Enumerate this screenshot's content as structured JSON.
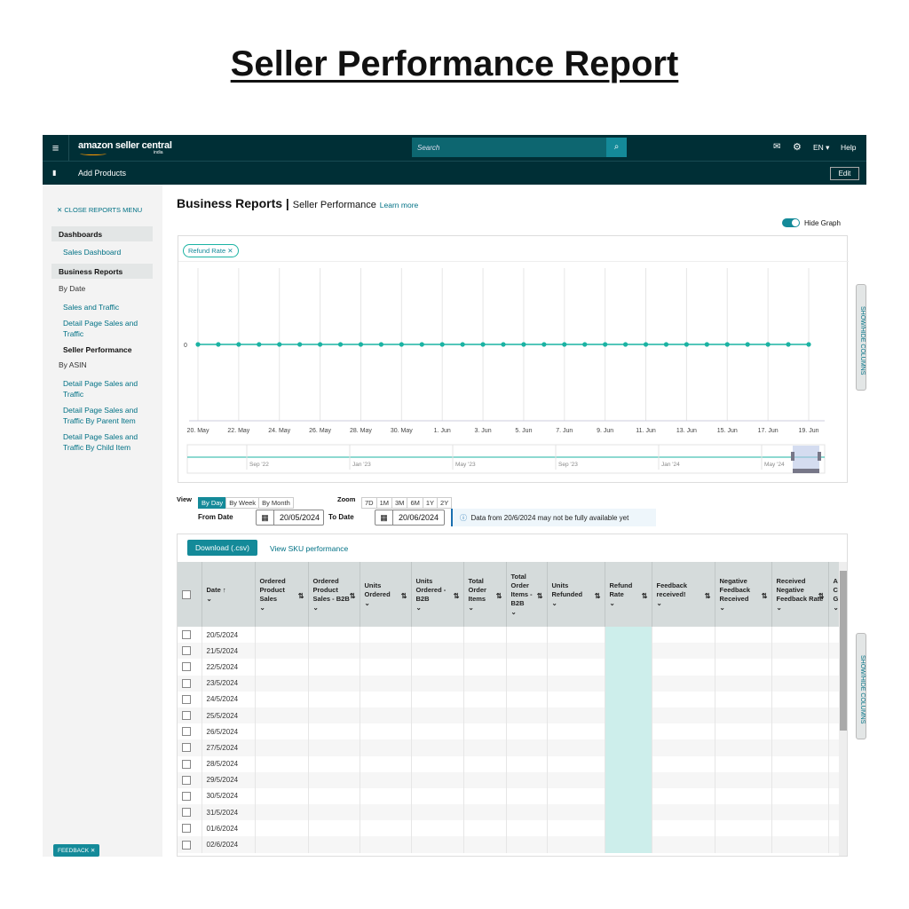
{
  "page_title": "Seller Performance Report",
  "topbar": {
    "logo": "amazon seller central",
    "logo_sub": "india",
    "search_placeholder": "Search",
    "language": "EN",
    "help": "Help",
    "icons": [
      "menu-icon",
      "search-icon",
      "mail-icon",
      "gear-icon"
    ]
  },
  "subbar": {
    "bookmark_label": "Add Products",
    "edit": "Edit"
  },
  "sidebar": {
    "close": "CLOSE REPORTS MENU",
    "dashboards": "Dashboards",
    "sales_dashboard": "Sales Dashboard",
    "business_reports": "Business Reports",
    "by_date": "By Date",
    "sales_traffic": "Sales and Traffic",
    "detail_sales_traffic": "Detail Page Sales and Traffic",
    "seller_performance": "Seller Performance",
    "by_asin": "By ASIN",
    "asin_detail": "Detail Page Sales and Traffic",
    "asin_parent": "Detail Page Sales and Traffic By Parent Item",
    "asin_child": "Detail Page Sales and Traffic By Child Item",
    "feedback": "FEEDBACK"
  },
  "header": {
    "title": "Business Reports",
    "subtitle": "Seller Performance",
    "learn_more": "Learn more",
    "hide_graph": "Hide Graph",
    "show_hide_columns": "SHOW/HIDE COLUMNS"
  },
  "chart_data": {
    "type": "line",
    "metric_chip": "Refund Rate",
    "color": "#1bb3a3",
    "x": [
      "20 May",
      "21 May",
      "22 May",
      "23 May",
      "24 May",
      "25 May",
      "26 May",
      "27 May",
      "28 May",
      "29 May",
      "30 May",
      "31 May",
      "1 Jun",
      "2 Jun",
      "3 Jun",
      "4 Jun",
      "5 Jun",
      "6 Jun",
      "7 Jun",
      "8 Jun",
      "9 Jun",
      "10 Jun",
      "11 Jun",
      "12 Jun",
      "13 Jun",
      "14 Jun",
      "15 Jun",
      "16 Jun",
      "17 Jun",
      "18 Jun",
      "19 Jun"
    ],
    "values": [
      0,
      0,
      0,
      0,
      0,
      0,
      0,
      0,
      0,
      0,
      0,
      0,
      0,
      0,
      0,
      0,
      0,
      0,
      0,
      0,
      0,
      0,
      0,
      0,
      0,
      0,
      0,
      0,
      0,
      0,
      0
    ],
    "y_tick_labels": [
      "0"
    ],
    "x_tick_labels": [
      "20. May",
      "22. May",
      "24. May",
      "26. May",
      "28. May",
      "30. May",
      "1. Jun",
      "3. Jun",
      "5. Jun",
      "7. Jun",
      "9. Jun",
      "11. Jun",
      "13. Jun",
      "15. Jun",
      "17. Jun",
      "19. Jun"
    ],
    "navigator_labels": [
      "Sep '22",
      "Jan '23",
      "May '23",
      "Sep '23",
      "Jan '24",
      "May '24"
    ],
    "grid": true
  },
  "controls": {
    "view_label": "View",
    "views": [
      "By Day",
      "By Week",
      "By Month"
    ],
    "active_view": "By Day",
    "zoom_label": "Zoom",
    "zooms": [
      "7D",
      "1M",
      "3M",
      "6M",
      "1Y",
      "2Y"
    ],
    "from_label": "From Date",
    "from_value": "20/05/2024",
    "to_label": "To Date",
    "to_value": "20/06/2024",
    "notice": "Data from 20/6/2024 may not be fully available yet"
  },
  "table": {
    "download": "Download (.csv)",
    "sku_link": "View SKU performance",
    "columns": [
      "Date",
      "Ordered Product Sales",
      "Ordered Product Sales - B2B",
      "Units Ordered",
      "Units Ordered - B2B",
      "Total Order Items",
      "Total Order Items - B2B",
      "Units Refunded",
      "Refund Rate",
      "Feedback received!",
      "Negative Feedback Received",
      "Received Negative Feedback Rate",
      "A C G"
    ],
    "dates": [
      "20/5/2024",
      "21/5/2024",
      "22/5/2024",
      "23/5/2024",
      "24/5/2024",
      "25/5/2024",
      "26/5/2024",
      "27/5/2024",
      "28/5/2024",
      "29/5/2024",
      "30/5/2024",
      "31/5/2024",
      "01/6/2024",
      "02/6/2024"
    ]
  }
}
